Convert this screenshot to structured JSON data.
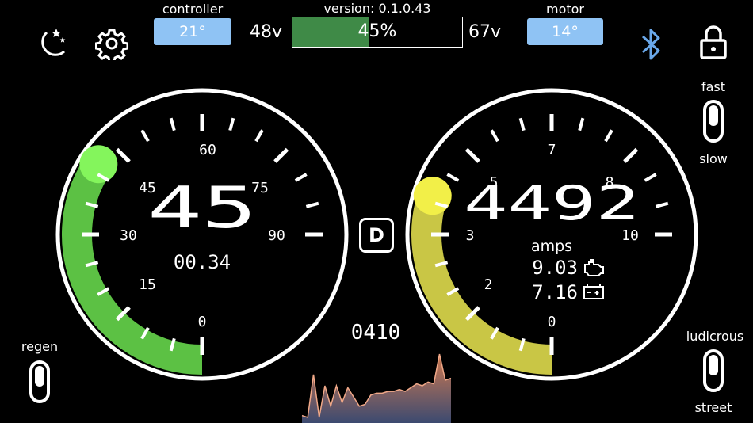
{
  "header": {
    "controller_label": "controller",
    "controller_temp": "21°",
    "version": "version: 0.1.0.43",
    "voltage_min": "48v",
    "voltage_max": "67v",
    "battery_percent": "45%",
    "battery_level": 0.45,
    "motor_label": "motor",
    "motor_temp": "14°"
  },
  "icons": {
    "night_mode": "moon-stars-icon",
    "settings": "gear-icon",
    "bluetooth": "bluetooth-icon",
    "lock": "lock-icon"
  },
  "toggles": {
    "fast": "fast",
    "slow": "slow",
    "regen": "regen",
    "ludicrous": "ludicrous",
    "street": "street"
  },
  "speed_gauge": {
    "value": "45",
    "trip": "00.34",
    "ticks": [
      "0",
      "15",
      "30",
      "45",
      "60",
      "75",
      "90"
    ],
    "arc_level": 0.46,
    "color": "#5cc144"
  },
  "drive_mode": "D",
  "odometer": "0410",
  "power_gauge": {
    "value": "4492",
    "unit": "amps",
    "motor_amps": "9.03",
    "battery_amps": "7.16",
    "ticks": [
      "0",
      "2",
      "3",
      "5",
      "7",
      "8",
      "10"
    ],
    "arc_level": 0.4,
    "color": "#c9c645"
  },
  "sparkline": {
    "values": [
      8,
      6,
      52,
      6,
      40,
      18,
      40,
      22,
      38,
      28,
      18,
      20,
      30,
      32,
      32,
      34,
      34,
      36,
      34,
      38,
      42,
      40,
      44,
      42,
      74,
      46,
      48
    ]
  }
}
